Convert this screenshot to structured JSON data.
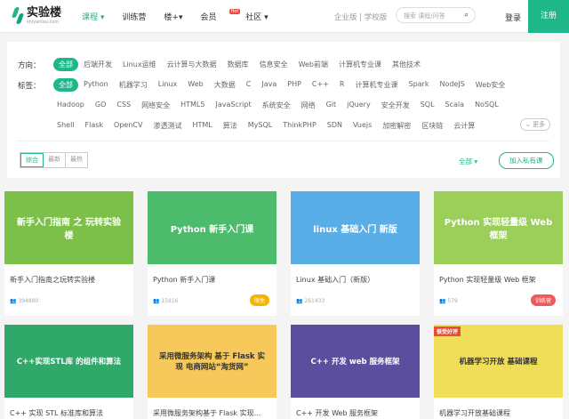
{
  "header": {
    "logo_cn": "实验楼",
    "logo_en": "shiyanlou.com",
    "nav": [
      "课程",
      "训练营",
      "楼+",
      "会员",
      "社区"
    ],
    "hot": "Hot",
    "versions": "企业版 | 学校版",
    "search_placeholder": "搜索 课程/问答",
    "login": "登录",
    "register": "注册"
  },
  "filters": {
    "direction_label": "方向：",
    "directions": [
      "全部",
      "后端开发",
      "Linux运维",
      "云计算与大数据",
      "数据库",
      "信息安全",
      "Web前端",
      "计算机专业课",
      "其他技术"
    ],
    "tags_label": "标签：",
    "tags_row1": [
      "全部",
      "Python",
      "机器学习",
      "Linux",
      "Web",
      "大数据",
      "C",
      "Java",
      "PHP",
      "C++",
      "R",
      "计算机专业课",
      "Spark",
      "NodeJS",
      "Web安全"
    ],
    "tags_row2": [
      "Hadoop",
      "GO",
      "CSS",
      "网络安全",
      "HTML5",
      "JavaScript",
      "系统安全",
      "网络",
      "Git",
      "jQuery",
      "安全开发",
      "SQL",
      "Scala",
      "NoSQL"
    ],
    "tags_row3": [
      "Shell",
      "Flask",
      "OpenCV",
      "渗透测试",
      "HTML",
      "算法",
      "MySQL",
      "ThinkPHP",
      "SDN",
      "Vuejs",
      "加密解密",
      "区块链",
      "云计算"
    ],
    "more": "更多",
    "sort": [
      "综合",
      "最新",
      "最热"
    ],
    "all": "全部",
    "join_private": "加入私有课"
  },
  "courses": [
    {
      "title": "新手入门指南之玩转实验楼",
      "count": "394890",
      "thumb": "新手入门指南 之 玩转实验楼",
      "color": "#7cc04a"
    },
    {
      "title": "Python 新手入门课",
      "count": "15916",
      "badge": "限免",
      "badge_color": "#f5b400",
      "thumb": "Python 新手入门课",
      "color": "#4cbb6c"
    },
    {
      "title": "Linux 基础入门（新版）",
      "count": "261433",
      "thumb": "linux 基础入门 新版",
      "color": "#5aaee8"
    },
    {
      "title": "Python 实现轻量级 Web 框架",
      "count": "579",
      "badge": "训练营",
      "badge_color": "#ee5b5b",
      "thumb": "Python 实现轻量级 Web 框架",
      "color": "#9ccf5a"
    },
    {
      "title": "C++ 实现 STL 标准库和算法",
      "thumb": "C++实现STL库 的组件和算法",
      "color": "#2fa86a"
    },
    {
      "title": "采用微服务架构基于 Flask 实现...",
      "thumb": "采用微服务架构 基于 Flask 实现 电商网站“淘货网”",
      "color": "#f7c85a"
    },
    {
      "title": "C++ 开发 Web 服务框架",
      "thumb": "C++ 开发 web 服务框架",
      "color": "#5c4e9e"
    },
    {
      "title": "机器学习开放基础课程",
      "ribbon": "很受好评",
      "thumb": "机器学习开放 基础课程",
      "color": "#f0de5a"
    }
  ]
}
